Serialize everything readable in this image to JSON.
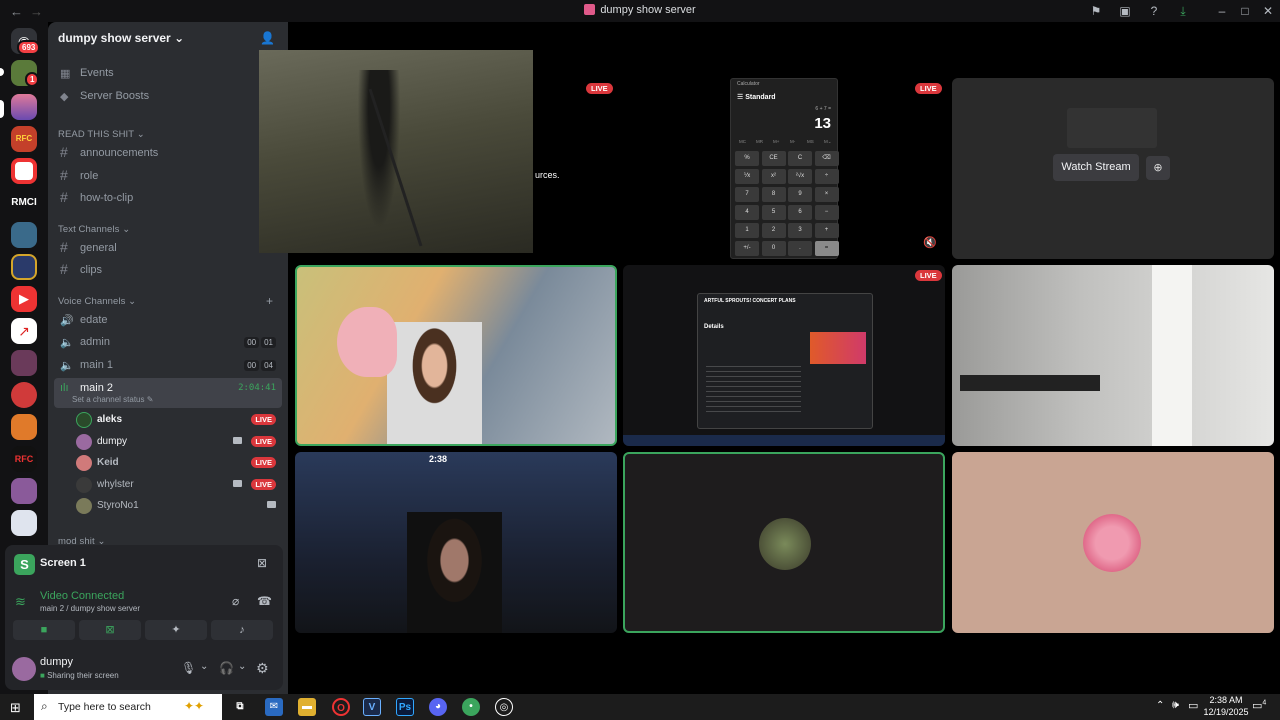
{
  "window": {
    "title": "dumpy show server",
    "back": "←",
    "forward": "→"
  },
  "guilds": {
    "home_badge": "693",
    "dm_badge": "1",
    "rmci_label": "RMCI",
    "rfc_label": "RFC"
  },
  "server": {
    "name": "dumpy show server",
    "chevron": "⌄"
  },
  "top_items": [
    {
      "label": "Events"
    },
    {
      "label": "Server Boosts"
    }
  ],
  "categories": {
    "read": "READ THIS SHIT",
    "text": "Text Channels",
    "voice": "Voice Channels",
    "mod": "mod shit"
  },
  "read_channels": [
    "announcements",
    "role",
    "how-to-clip"
  ],
  "text_channels": [
    "general",
    "clips"
  ],
  "voice_channels": [
    {
      "name": "edate"
    },
    {
      "name": "admin",
      "c1": "00",
      "c2": "01"
    },
    {
      "name": "main 1",
      "c1": "00",
      "c2": "04"
    },
    {
      "name": "main 2",
      "time": "2:04:41",
      "status": "Set a channel status"
    }
  ],
  "voice_users": [
    {
      "name": "aleks",
      "live": "LIVE"
    },
    {
      "name": "dumpy",
      "live": "LIVE"
    },
    {
      "name": "Keid",
      "live": "LIVE"
    },
    {
      "name": "whylster",
      "live": "LIVE"
    },
    {
      "name": "StyroNo1",
      "live": ""
    }
  ],
  "screen_panel": {
    "title": "Screen 1",
    "connected": "Video Connected",
    "location": "main 2 / dumpy show server"
  },
  "account": {
    "name": "dumpy",
    "status": "Sharing their screen"
  },
  "streams": {
    "live_label": "LIVE",
    "watch_label": "Watch Stream",
    "overlay_text": "urces.",
    "timestamp": "2:38"
  },
  "calculator": {
    "app": "Calculator",
    "mode": "Standard",
    "expression": "6 + 7 =",
    "result": "13",
    "memory": [
      "MC",
      "MR",
      "M+",
      "M-",
      "MS",
      "M⌄"
    ],
    "keys": [
      "%",
      "CE",
      "C",
      "⌫",
      "⅟x",
      "x²",
      "²√x",
      "÷",
      "7",
      "8",
      "9",
      "×",
      "4",
      "5",
      "6",
      "−",
      "1",
      "2",
      "3",
      "+",
      "+/-",
      "0",
      ".",
      "="
    ]
  },
  "inner_stream": {
    "header": "ARTFUL SPROUTS! CONCERT PLANS",
    "details": "Details"
  },
  "taskbar": {
    "search_placeholder": "Type here to search",
    "time": "2:38 AM",
    "date": "12/19/2025",
    "notif_count": "4"
  },
  "colors": {
    "accent_green": "#3ba55d",
    "live_red": "#da373c",
    "sidebar": "#2b2d31"
  }
}
